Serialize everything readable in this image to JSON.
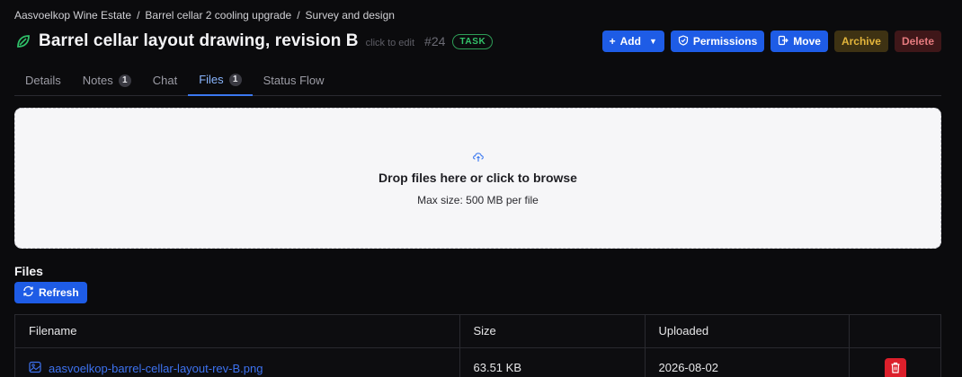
{
  "breadcrumb": [
    "Aasvoelkop Wine Estate",
    "Barrel cellar 2 cooling upgrade",
    "Survey and design"
  ],
  "header": {
    "title": "Barrel cellar layout drawing, revision B",
    "click_to_edit": "click to edit",
    "task_number": "#24",
    "badge": "TASK"
  },
  "actions": {
    "add": "Add",
    "permissions": "Permissions",
    "move": "Move",
    "archive": "Archive",
    "delete": "Delete"
  },
  "tabs": [
    {
      "label": "Details",
      "count": ""
    },
    {
      "label": "Notes",
      "count": "1"
    },
    {
      "label": "Chat",
      "count": ""
    },
    {
      "label": "Files",
      "count": "1"
    },
    {
      "label": "Status Flow",
      "count": ""
    }
  ],
  "dropzone": {
    "title": "Drop files here or click to browse",
    "subtitle": "Max size: 500 MB per file"
  },
  "files": {
    "heading": "Files",
    "refresh": "Refresh",
    "columns": [
      "Filename",
      "Size",
      "Uploaded",
      ""
    ],
    "rows": [
      {
        "filename": "aasvoelkop-barrel-cellar-layout-rev-B.png",
        "size": "63.51 KB",
        "uploaded": "2026-08-02"
      }
    ]
  },
  "colors": {
    "accent": "#1e5ce6",
    "badge_green": "#33c46a",
    "archive": "#e3b53b",
    "delete": "#dc1f2b"
  }
}
